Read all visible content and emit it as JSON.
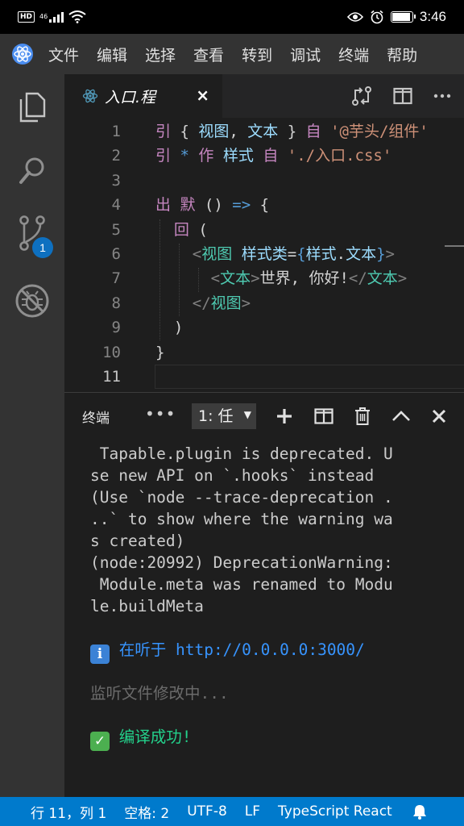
{
  "phone_status": {
    "network": "46",
    "time": "3:46"
  },
  "menu": [
    "文件",
    "编辑",
    "选择",
    "查看",
    "转到",
    "调试",
    "终端",
    "帮助"
  ],
  "activity": {
    "scm_badge": "1"
  },
  "tab": {
    "label": "入口.程",
    "close": "×"
  },
  "editor": {
    "line_numbers": [
      "1",
      "2",
      "3",
      "4",
      "5",
      "6",
      "7",
      "8",
      "9",
      "10",
      "11"
    ],
    "lines": [
      [
        [
          "k",
          "引"
        ],
        [
          "p",
          " { "
        ],
        [
          "v",
          "视图"
        ],
        [
          "p",
          ", "
        ],
        [
          "v",
          "文本"
        ],
        [
          "p",
          " } "
        ],
        [
          "k",
          "自"
        ],
        [
          "p",
          " "
        ],
        [
          "s",
          "'@芋头/组件'"
        ]
      ],
      [
        [
          "k",
          "引"
        ],
        [
          "p",
          " "
        ],
        [
          "b",
          "*"
        ],
        [
          "p",
          " "
        ],
        [
          "k",
          "作"
        ],
        [
          "p",
          " "
        ],
        [
          "v",
          "样式"
        ],
        [
          "p",
          " "
        ],
        [
          "k",
          "自"
        ],
        [
          "p",
          " "
        ],
        [
          "s",
          "'./入口.css'"
        ]
      ],
      [],
      [
        [
          "k",
          "出"
        ],
        [
          "p",
          " "
        ],
        [
          "k",
          "默"
        ],
        [
          "p",
          " () "
        ],
        [
          "b",
          "=>"
        ],
        [
          "p",
          " {"
        ]
      ],
      [
        [
          "p",
          "  "
        ],
        [
          "k",
          "回"
        ],
        [
          "p",
          " ("
        ]
      ],
      [
        [
          "p",
          "    "
        ],
        [
          "g",
          "<"
        ],
        [
          "t",
          "视图"
        ],
        [
          "p",
          " "
        ],
        [
          "v",
          "样式类"
        ],
        [
          "p",
          "="
        ],
        [
          "b",
          "{"
        ],
        [
          "v",
          "样式"
        ],
        [
          "p",
          "."
        ],
        [
          "v",
          "文本"
        ],
        [
          "b",
          "}"
        ],
        [
          "g",
          ">"
        ]
      ],
      [
        [
          "p",
          "      "
        ],
        [
          "g",
          "<"
        ],
        [
          "t",
          "文本"
        ],
        [
          "g",
          ">"
        ],
        [
          "p",
          "世界, 你好!"
        ],
        [
          "g",
          "</"
        ],
        [
          "t",
          "文本"
        ],
        [
          "g",
          ">"
        ]
      ],
      [
        [
          "p",
          "    "
        ],
        [
          "g",
          "</"
        ],
        [
          "t",
          "视图"
        ],
        [
          "g",
          ">"
        ]
      ],
      [
        [
          "p",
          "  )"
        ]
      ],
      [
        [
          "p",
          "}"
        ]
      ],
      []
    ]
  },
  "panel": {
    "title": "终端",
    "more": "•••",
    "terminal_select": "1: 任",
    "terminal_output": [
      {
        "kind": "plain",
        "text": " Tapable.plugin is deprecated. U"
      },
      {
        "kind": "plain",
        "text": "se new API on `.hooks` instead"
      },
      {
        "kind": "plain",
        "text": "(Use `node --trace-deprecation ."
      },
      {
        "kind": "plain",
        "text": "..` to show where the warning wa"
      },
      {
        "kind": "plain",
        "text": "s created)"
      },
      {
        "kind": "plain",
        "text": "(node:20992) DeprecationWarning:"
      },
      {
        "kind": "plain",
        "text": " Module.meta was renamed to Modu"
      },
      {
        "kind": "plain",
        "text": "le.buildMeta"
      },
      {
        "kind": "blank",
        "text": ""
      },
      {
        "kind": "info",
        "text": " 在听于 http://0.0.0.0:3000/"
      },
      {
        "kind": "blank",
        "text": ""
      },
      {
        "kind": "watch",
        "text": "监听文件修改中..."
      },
      {
        "kind": "blank",
        "text": ""
      },
      {
        "kind": "ok",
        "text": " 编译成功!"
      }
    ]
  },
  "statusbar": {
    "position": "行 11，列 1",
    "indent": "空格: 2",
    "encoding": "UTF-8",
    "eol": "LF",
    "language": "TypeScript React"
  },
  "colors": {
    "accent": "#007acc",
    "badge": "#0e70c0",
    "keyword": "#c586c0",
    "string": "#ce9178",
    "tag": "#4ec9b0"
  }
}
